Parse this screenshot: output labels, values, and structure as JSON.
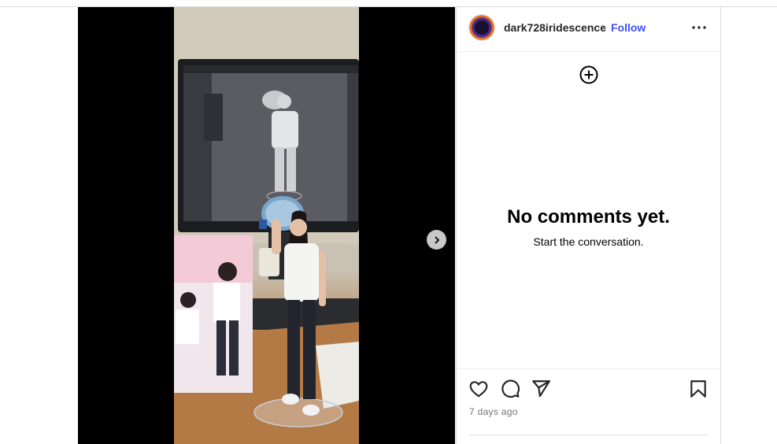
{
  "post": {
    "username": "dark728iridescence",
    "separator": "•",
    "follow_label": "Follow",
    "more_icon": "more-options-icon",
    "timestamp": "7 days ago"
  },
  "comments": {
    "empty_title": "No comments yet.",
    "empty_subtitle": "Start the conversation."
  },
  "media": {
    "alt": "Photo of a figure holding a water jug in front of a monitor showing a 3D model",
    "next_icon": "chevron-right-icon"
  },
  "actions": {
    "like_icon": "heart-icon",
    "comment_icon": "comment-icon",
    "share_icon": "share-icon",
    "save_icon": "bookmark-icon"
  },
  "colors": {
    "follow": "#4150f7",
    "muted": "#737373",
    "divider": "#dbdbdb"
  }
}
